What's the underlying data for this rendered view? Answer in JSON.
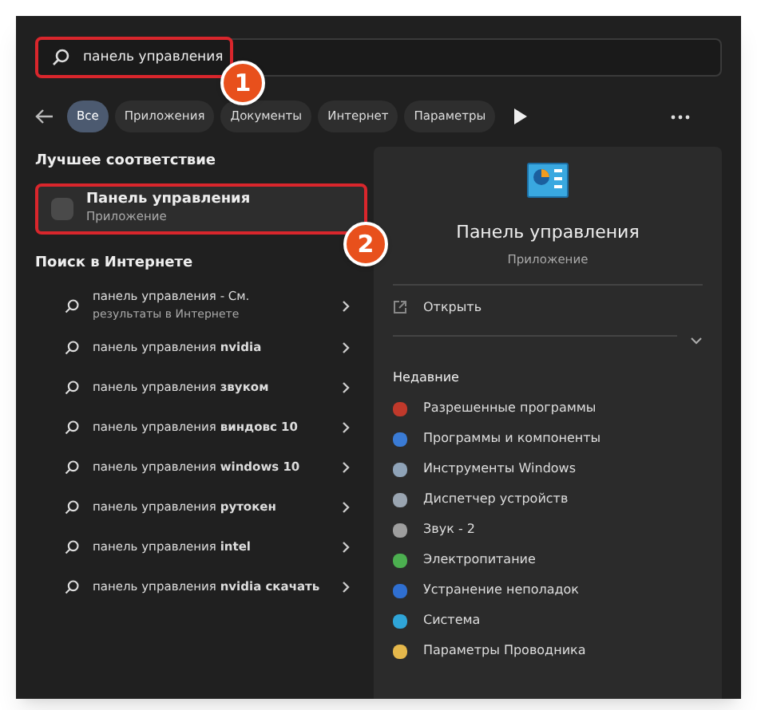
{
  "search": {
    "value": "панель управления",
    "highlighted": true,
    "badge": "1"
  },
  "filters": [
    {
      "label": "Все",
      "selected": true
    },
    {
      "label": "Приложения",
      "selected": false
    },
    {
      "label": "Документы",
      "selected": false
    },
    {
      "label": "Интернет",
      "selected": false
    },
    {
      "label": "Параметры",
      "selected": false
    }
  ],
  "best_match": {
    "heading": "Лучшее соответствие",
    "title": "Панель управления",
    "subtitle": "Приложение",
    "highlighted": true,
    "badge": "2"
  },
  "web": {
    "heading": "Поиск в Интернете",
    "items": [
      {
        "text": "панель управления - См.",
        "subtext": "результаты в Интернете"
      },
      {
        "text": "панель управления **nvidia**"
      },
      {
        "text": "панель управления **звуком**"
      },
      {
        "text": "панель управления **виндовс 10**"
      },
      {
        "text": "панель управления **windows 10**"
      },
      {
        "text": "панель управления **рутокен**"
      },
      {
        "text": "панель управления **intel**"
      },
      {
        "text": "панель управления **nvidia скачать**"
      }
    ]
  },
  "preview": {
    "title": "Панель управления",
    "subtitle": "Приложение",
    "open": "Открыть",
    "recent_heading": "Недавние",
    "recent": [
      {
        "label": "Разрешенные программы",
        "color": "#c0392b"
      },
      {
        "label": "Программы и компоненты",
        "color": "#3a7bd5"
      },
      {
        "label": "Инструменты Windows",
        "color": "#8fa3b8"
      },
      {
        "label": "Диспетчер устройств",
        "color": "#9aa5b1"
      },
      {
        "label": "Звук - 2",
        "color": "#9e9e9e"
      },
      {
        "label": "Электропитание",
        "color": "#4caf50"
      },
      {
        "label": "Устранение неполадок",
        "color": "#2f6fd1"
      },
      {
        "label": "Система",
        "color": "#2fa5d8"
      },
      {
        "label": "Параметры Проводника",
        "color": "#e5b84b"
      }
    ]
  }
}
